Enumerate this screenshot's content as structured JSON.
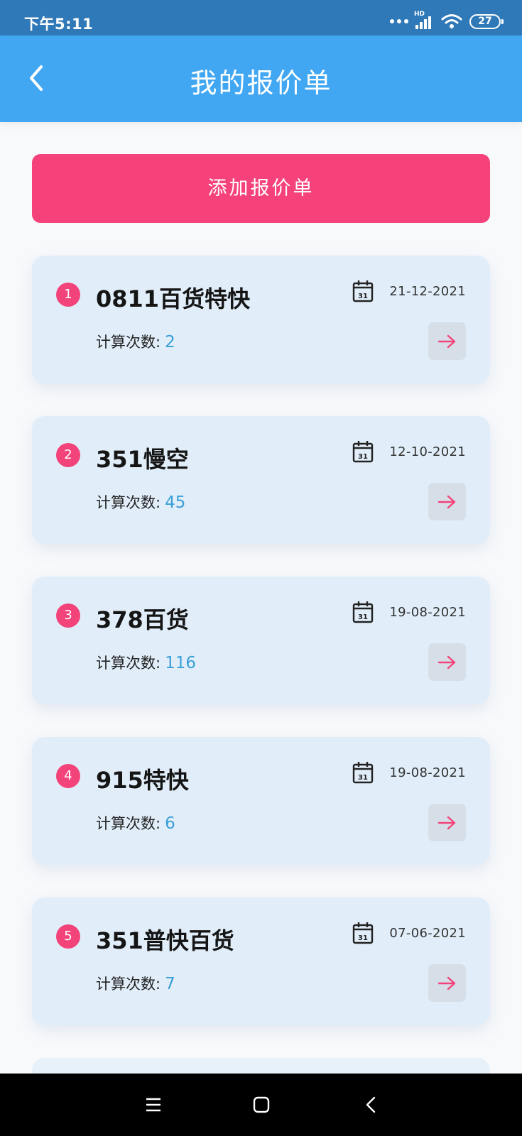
{
  "status_bar": {
    "time": "下午5:11",
    "network_label": "HD",
    "battery": "27"
  },
  "header": {
    "title": "我的报价单",
    "back_icon": "chevron-left-icon"
  },
  "add_button_label": "添加报价单",
  "quotes": [
    {
      "index": "1",
      "name": "0811百货特快",
      "date": "21-12-2021",
      "count_label": "计算次数:",
      "count": "2"
    },
    {
      "index": "2",
      "name": "351慢空",
      "date": "12-10-2021",
      "count_label": "计算次数:",
      "count": "45"
    },
    {
      "index": "3",
      "name": "378百货",
      "date": "19-08-2021",
      "count_label": "计算次数:",
      "count": "116"
    },
    {
      "index": "4",
      "name": "915特快",
      "date": "19-08-2021",
      "count_label": "计算次数:",
      "count": "6"
    },
    {
      "index": "5",
      "name": "351普快百货",
      "date": "07-06-2021",
      "count_label": "计算次数:",
      "count": "7"
    }
  ],
  "calendar_icon_text": "31",
  "colors": {
    "header": "#42a7f2",
    "status_bar": "#3079b8",
    "accent_pink": "#f5427b",
    "count_blue": "#3a9fd8",
    "card_bg": "#e1eef9"
  },
  "icons": {
    "calendar": "calendar-icon",
    "open": "arrow-right-icon",
    "nav_menu": "menu-icon",
    "nav_home": "home-square-icon",
    "nav_back": "back-triangle-icon"
  }
}
